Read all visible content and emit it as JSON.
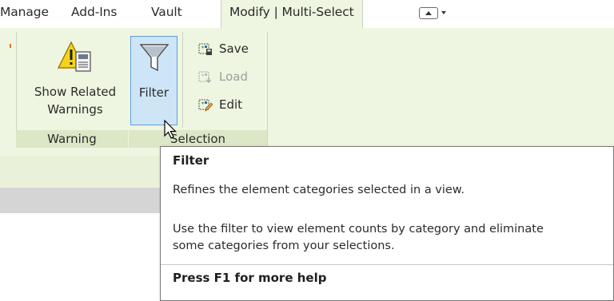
{
  "tabs": [
    {
      "label": "Manage"
    },
    {
      "label": "Add-Ins"
    },
    {
      "label": "Vault"
    },
    {
      "label": "Modify | Multi-Select",
      "active": true
    }
  ],
  "ribbon": {
    "warning_panel": {
      "button_label_line1": "Show Related",
      "button_label_line2": "Warnings",
      "footer": "Warning"
    },
    "filter_button": {
      "label": "Filter",
      "state": "hovered"
    },
    "selection_panel": {
      "save_label": "Save",
      "load_label": "Load",
      "edit_label": "Edit",
      "footer": "Selection"
    }
  },
  "tooltip": {
    "title": "Filter",
    "summary": "Refines the element categories selected in a view.",
    "description_line1": "Use the filter to view element counts by category and eliminate",
    "description_line2": "some categories from your selections.",
    "help": "Press F1 for more help"
  },
  "icons": {
    "warning": "warning-icon",
    "filter": "funnel-icon",
    "save": "save-selection-icon",
    "load": "load-selection-icon",
    "edit": "edit-selection-icon",
    "qat": "quick-access-toolbar-icon",
    "cursor": "mouse-pointer-icon"
  },
  "colors": {
    "ribbon_bg": "#eef5e0",
    "panel_footer_bg": "#dbe7c6",
    "hover_bg": "#cde5f7",
    "hover_border": "#5d9ed6"
  }
}
